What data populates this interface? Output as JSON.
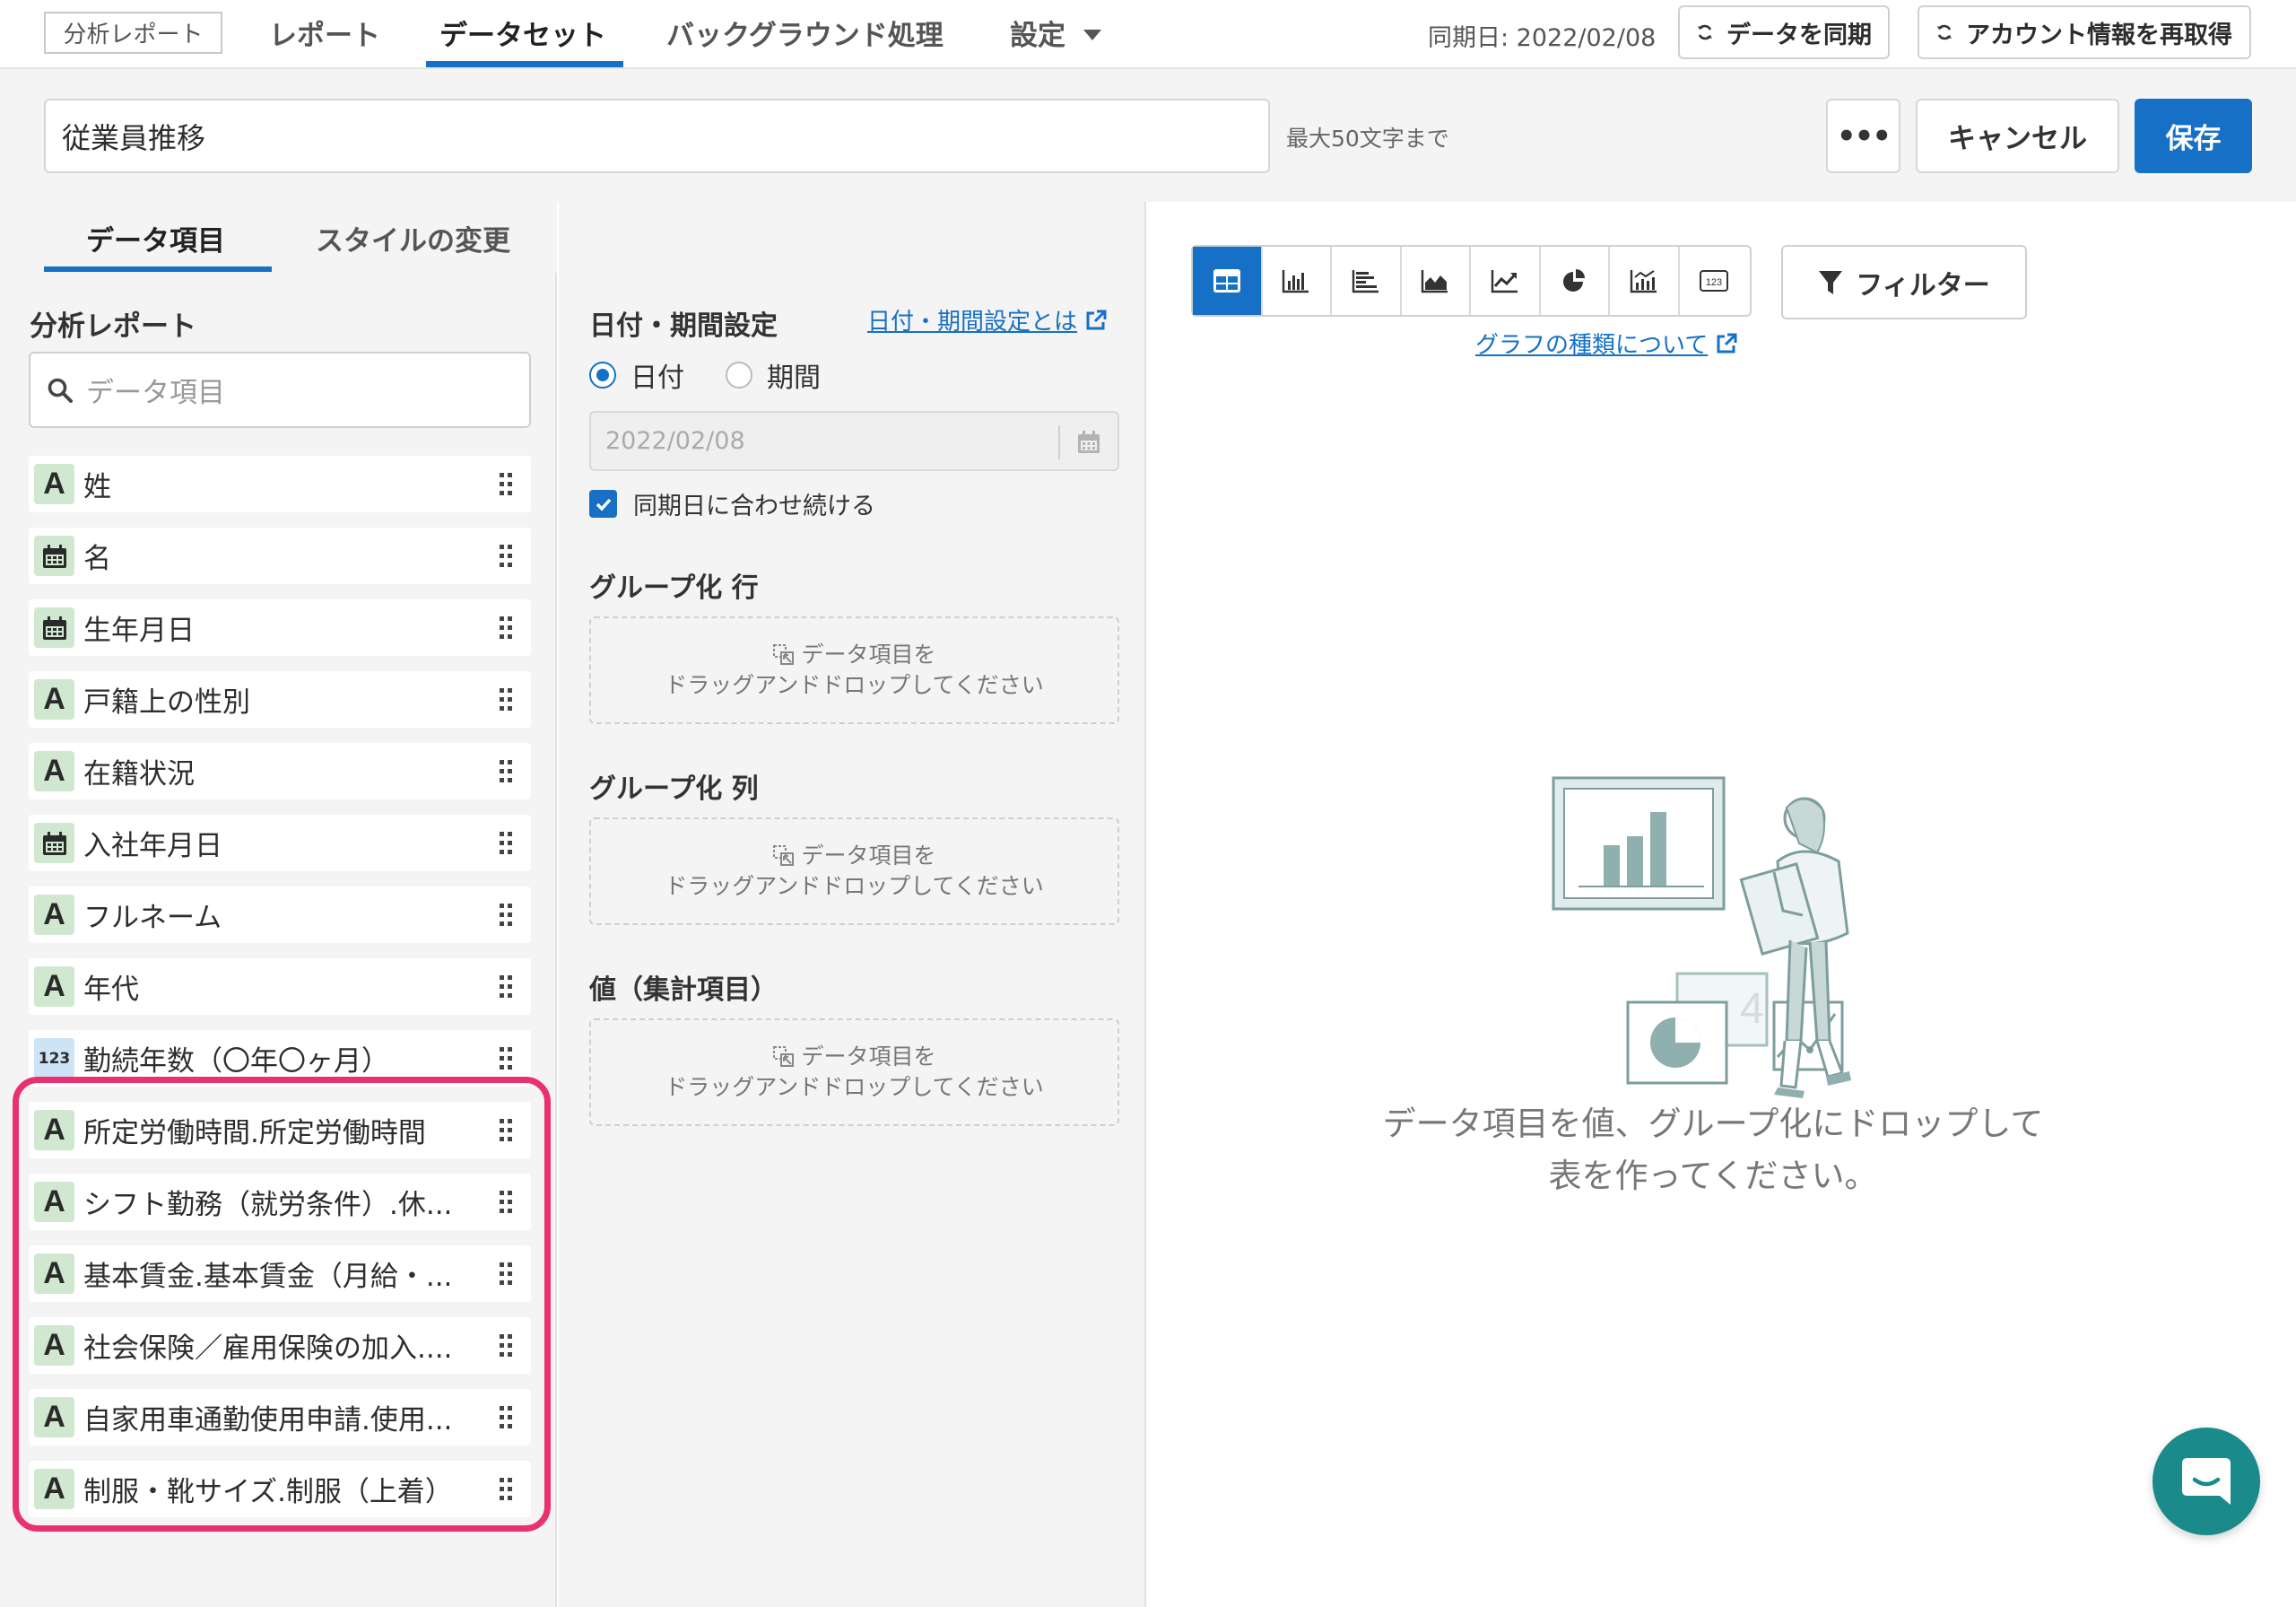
{
  "nav": {
    "brand": "分析レポート",
    "tabs": [
      "レポート",
      "データセット",
      "バックグラウンド処理",
      "設定"
    ],
    "sync_date": "同期日: 2022/02/08",
    "sync_button": "データを同期",
    "refetch_button": "アカウント情報を再取得"
  },
  "title_bar": {
    "title_value": "従業員推移",
    "hint": "最大50文字まで",
    "more_label": "•••",
    "cancel_label": "キャンセル",
    "save_label": "保存"
  },
  "left_panel": {
    "tabs": [
      "データ項目",
      "スタイルの変更"
    ],
    "heading": "分析レポート",
    "search_placeholder": "データ項目",
    "fields": [
      {
        "type": "A",
        "label": "姓"
      },
      {
        "type": "date",
        "label": "名"
      },
      {
        "type": "date",
        "label": "生年月日"
      },
      {
        "type": "A",
        "label": "戸籍上の性別"
      },
      {
        "type": "A",
        "label": "在籍状況"
      },
      {
        "type": "date",
        "label": "入社年月日"
      },
      {
        "type": "A",
        "label": "フルネーム"
      },
      {
        "type": "A",
        "label": "年代"
      },
      {
        "type": "123",
        "label": "勤続年数（〇年〇ヶ月）"
      },
      {
        "type": "A",
        "label": "所定労働時間.所定労働時間"
      },
      {
        "type": "A",
        "label": "シフト勤務（就労条件）.休..."
      },
      {
        "type": "A",
        "label": "基本賃金.基本賃金（月給・..."
      },
      {
        "type": "A",
        "label": "社会保険／雇用保険の加入...."
      },
      {
        "type": "A",
        "label": "自家用車通勤使用申請.使用..."
      },
      {
        "type": "A",
        "label": "制服・靴サイズ.制服（上着）"
      }
    ],
    "badge_A": "A",
    "badge_num": "123"
  },
  "middle_panel": {
    "date_heading": "日付・期間設定",
    "date_help_link": "日付・期間設定とは",
    "radio_date": "日付",
    "radio_period": "期間",
    "date_value": "2022/02/08",
    "keep_sync_label": "同期日に合わせ続ける",
    "group_row_heading": "グループ化 行",
    "group_col_heading": "グループ化 列",
    "values_heading": "値（集計項目）",
    "dropzone_line1": "データ項目を",
    "dropzone_line2": "ドラッグアンドドロップしてください"
  },
  "right_panel": {
    "chart_type_icons": [
      "table-icon",
      "bar-chart-icon",
      "horizontal-bar-icon",
      "area-chart-icon",
      "line-chart-icon",
      "pie-chart-icon",
      "combo-chart-icon",
      "number-icon"
    ],
    "filter_label": "フィルター",
    "graph_types_link": "グラフの種類について",
    "empty_message_line1": "データ項目を値、グループ化にドロップして",
    "empty_message_line2": "表を作ってください。",
    "number_icon_text": "123"
  },
  "colors": {
    "accent": "#1670c5",
    "highlight": "#e8316e",
    "chat": "#1b8a8a"
  }
}
